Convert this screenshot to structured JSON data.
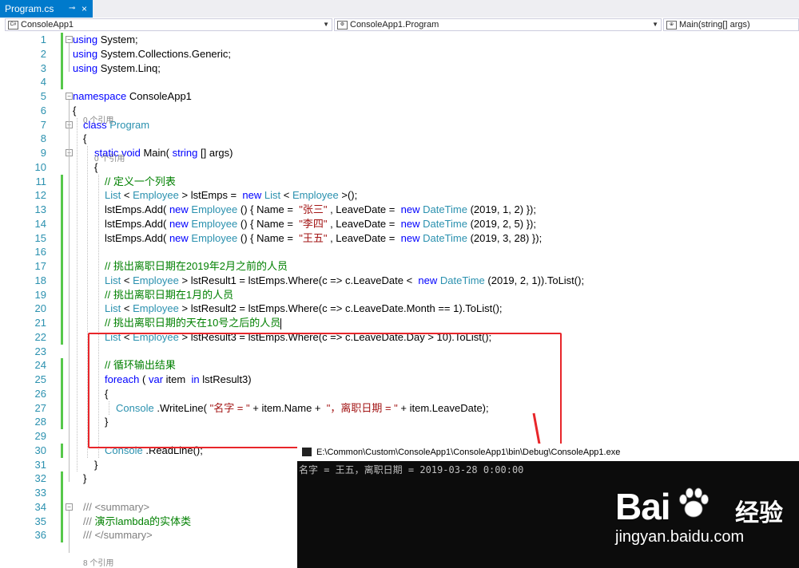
{
  "tab": {
    "filename": "Program.cs",
    "pin_icon": "pin-icon",
    "close_icon": "close-icon"
  },
  "navbar": {
    "project": "ConsoleApp1",
    "class": "ConsoleApp1.Program",
    "member": "Main(string[] args)"
  },
  "editor": {
    "line_numbers": [
      "1",
      "2",
      "3",
      "4",
      "5",
      "6",
      "7",
      "8",
      "9",
      "10",
      "11",
      "12",
      "13",
      "14",
      "15",
      "16",
      "17",
      "18",
      "19",
      "20",
      "21",
      "22",
      "23",
      "24",
      "25",
      "26",
      "27",
      "28",
      "29",
      "30",
      "31",
      "32",
      "33",
      "34",
      "35",
      "36"
    ],
    "codelens": [
      "0 个引用",
      "0 个引用",
      "8 个引用"
    ],
    "lines": [
      {
        "n": "1",
        "segs": [
          [
            "kw",
            "using"
          ],
          [
            "",
            "System;"
          ]
        ]
      },
      {
        "n": "2",
        "segs": [
          [
            "kw",
            "using"
          ],
          [
            "",
            "System.Collections.Generic;"
          ]
        ]
      },
      {
        "n": "3",
        "segs": [
          [
            "kw",
            "using"
          ],
          [
            "",
            "System.Linq;"
          ]
        ]
      },
      {
        "n": "5",
        "segs": [
          [
            "kw",
            "namespace"
          ],
          [
            "",
            "ConsoleApp1"
          ]
        ]
      },
      {
        "n": "6",
        "segs": [
          [
            "",
            "{"
          ]
        ]
      },
      {
        "n": "7",
        "segs": [
          [
            "kw",
            "class"
          ],
          [
            "ty",
            "Program"
          ]
        ]
      },
      {
        "n": "8",
        "segs": [
          [
            "",
            "{"
          ]
        ]
      },
      {
        "n": "9",
        "segs": [
          [
            "kw",
            "static void"
          ],
          [
            "",
            "Main("
          ],
          [
            "kw",
            "string"
          ],
          [
            "",
            "[] args)"
          ]
        ]
      },
      {
        "n": "10",
        "segs": [
          [
            "",
            "{"
          ]
        ]
      },
      {
        "n": "11",
        "segs": [
          [
            "cm",
            "// 定义一个列表"
          ]
        ]
      },
      {
        "n": "12",
        "segs": [
          [
            "ty",
            "List"
          ],
          [
            "",
            "<"
          ],
          [
            "ty",
            "Employee"
          ],
          [
            "",
            "> lstEmps = "
          ],
          [
            "kw",
            "new"
          ],
          [
            "ty",
            "List"
          ],
          [
            "",
            "<"
          ],
          [
            "ty",
            "Employee"
          ],
          [
            "",
            ">();"
          ]
        ]
      },
      {
        "n": "13",
        "segs": [
          [
            "",
            "lstEmps.Add("
          ],
          [
            "kw",
            "new"
          ],
          [
            "ty",
            "Employee"
          ],
          [
            "",
            "() { Name = "
          ],
          [
            "st",
            "\"张三\""
          ],
          [
            "",
            ", LeaveDate = "
          ],
          [
            "kw",
            "new"
          ],
          [
            "ty",
            "DateTime"
          ],
          [
            "",
            "(2019, 1, 2) });"
          ]
        ]
      },
      {
        "n": "14",
        "segs": [
          [
            "",
            "lstEmps.Add("
          ],
          [
            "kw",
            "new"
          ],
          [
            "ty",
            "Employee"
          ],
          [
            "",
            "() { Name = "
          ],
          [
            "st",
            "\"李四\""
          ],
          [
            "",
            ", LeaveDate = "
          ],
          [
            "kw",
            "new"
          ],
          [
            "ty",
            "DateTime"
          ],
          [
            "",
            "(2019, 2, 5) });"
          ]
        ]
      },
      {
        "n": "15",
        "segs": [
          [
            "",
            "lstEmps.Add("
          ],
          [
            "kw",
            "new"
          ],
          [
            "ty",
            "Employee"
          ],
          [
            "",
            "() { Name = "
          ],
          [
            "st",
            "\"王五\""
          ],
          [
            "",
            ", LeaveDate = "
          ],
          [
            "kw",
            "new"
          ],
          [
            "ty",
            "DateTime"
          ],
          [
            "",
            "(2019, 3, 28) });"
          ]
        ]
      },
      {
        "n": "17",
        "segs": [
          [
            "cm",
            "// 挑出离职日期在2019年2月之前的人员"
          ]
        ]
      },
      {
        "n": "18",
        "segs": [
          [
            "ty",
            "List"
          ],
          [
            "",
            "<"
          ],
          [
            "ty",
            "Employee"
          ],
          [
            "",
            "> lstResult1 = lstEmps.Where(c => c.LeaveDate < "
          ],
          [
            "kw",
            "new"
          ],
          [
            "ty",
            "DateTime"
          ],
          [
            "",
            "(2019, 2, 1)).ToList();"
          ]
        ]
      },
      {
        "n": "19",
        "segs": [
          [
            "cm",
            "// 挑出离职日期在1月的人员"
          ]
        ]
      },
      {
        "n": "20",
        "segs": [
          [
            "ty",
            "List"
          ],
          [
            "",
            "<"
          ],
          [
            "ty",
            "Employee"
          ],
          [
            "",
            "> lstResult2 = lstEmps.Where(c => c.LeaveDate.Month == 1).ToList();"
          ]
        ]
      },
      {
        "n": "21",
        "segs": [
          [
            "cm",
            "// 挑出离职日期的天在10号之后的人员"
          ]
        ]
      },
      {
        "n": "22",
        "segs": [
          [
            "ty",
            "List"
          ],
          [
            "",
            "<"
          ],
          [
            "ty",
            "Employee"
          ],
          [
            "",
            "> lstResult3 = lstEmps.Where(c => c.LeaveDate.Day > 10).ToList();"
          ]
        ]
      },
      {
        "n": "24",
        "segs": [
          [
            "cm",
            "// 循环输出结果"
          ]
        ]
      },
      {
        "n": "25",
        "segs": [
          [
            "kw",
            "foreach"
          ],
          [
            "",
            "("
          ],
          [
            "kw",
            "var"
          ],
          [
            "",
            "item "
          ],
          [
            "kw",
            "in"
          ],
          [
            "",
            "lstResult3)"
          ]
        ]
      },
      {
        "n": "26",
        "segs": [
          [
            "",
            "{"
          ]
        ]
      },
      {
        "n": "27",
        "segs": [
          [
            "ty",
            "Console"
          ],
          [
            "",
            ".WriteLine("
          ],
          [
            "st",
            "\"名字 = \""
          ],
          [
            "",
            "+ item.Name + "
          ],
          [
            "st",
            "\"，离职日期 = \""
          ],
          [
            "",
            "+ item.LeaveDate);"
          ]
        ]
      },
      {
        "n": "28",
        "segs": [
          [
            "",
            "}"
          ]
        ]
      },
      {
        "n": "30",
        "segs": [
          [
            "ty",
            "Console"
          ],
          [
            "",
            ".ReadLine();"
          ]
        ]
      },
      {
        "n": "31",
        "segs": [
          [
            "",
            "}"
          ]
        ]
      },
      {
        "n": "32",
        "segs": [
          [
            "",
            "}"
          ]
        ]
      },
      {
        "n": "34",
        "segs": [
          [
            "doc",
            "/// <summary>"
          ]
        ]
      },
      {
        "n": "35",
        "segs": [
          [
            "doc",
            "///"
          ],
          [
            "cm",
            "演示lambda的实体类"
          ]
        ]
      },
      {
        "n": "36",
        "segs": [
          [
            "doc",
            "/// </summary>"
          ]
        ]
      }
    ]
  },
  "console": {
    "title": "E:\\Common\\Custom\\ConsoleApp1\\ConsoleApp1\\bin\\Debug\\ConsoleApp1.exe",
    "output": "名字 = 王五，离职日期 = 2019-03-28 0:00:00"
  },
  "watermark": {
    "brand": "Bai",
    "brand2": "经验",
    "url": "jingyan.baidu.com"
  },
  "colors": {
    "accent": "#007acc",
    "keyword": "#0000ff",
    "type": "#2b91af",
    "comment": "#008000",
    "string": "#a31515",
    "annotation_red": "#e8262a"
  }
}
